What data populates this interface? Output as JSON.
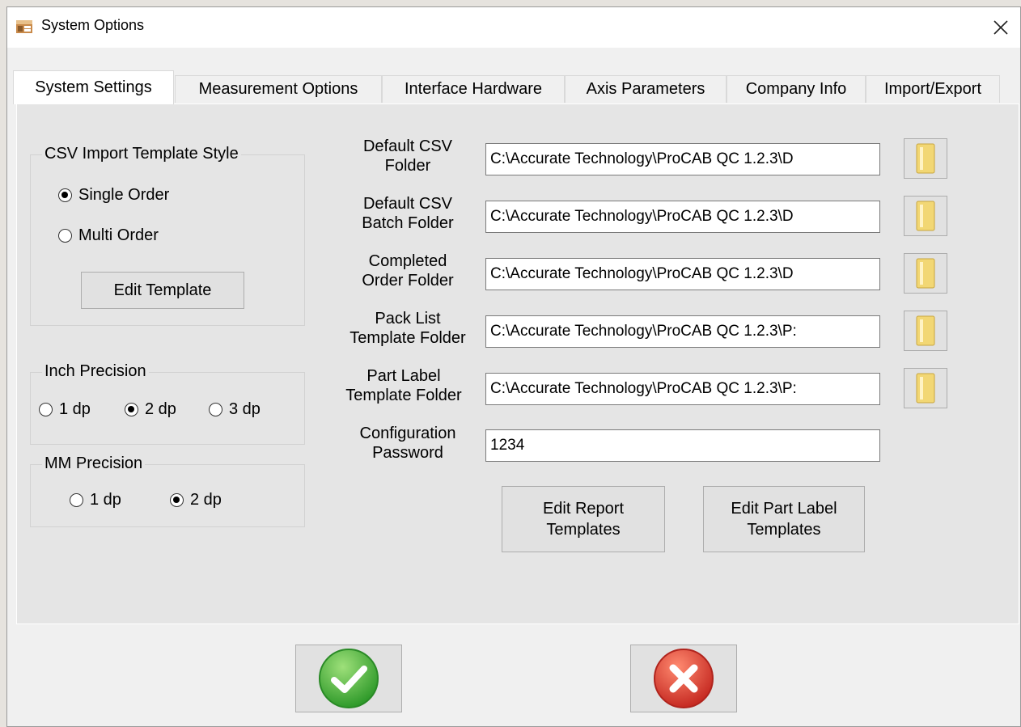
{
  "window": {
    "title": "System Options"
  },
  "tabs": [
    {
      "label": "System Settings"
    },
    {
      "label": "Measurement Options"
    },
    {
      "label": "Interface Hardware"
    },
    {
      "label": "Axis Parameters"
    },
    {
      "label": "Company Info"
    },
    {
      "label": "Import/Export"
    }
  ],
  "csv_template": {
    "legend": "CSV Import Template Style",
    "options": [
      "Single Order",
      "Multi Order"
    ],
    "selected": "Single Order",
    "edit_button": "Edit Template"
  },
  "inch_precision": {
    "legend": "Inch Precision",
    "options": [
      "1 dp",
      "2 dp",
      "3 dp"
    ],
    "selected": "2 dp"
  },
  "mm_precision": {
    "legend": "MM Precision",
    "options": [
      "1 dp",
      "2 dp"
    ],
    "selected": "2 dp"
  },
  "folders": [
    {
      "label": "Default CSV\nFolder",
      "value": "C:\\Accurate Technology\\ProCAB QC 1.2.3\\D"
    },
    {
      "label": "Default CSV\nBatch Folder",
      "value": "C:\\Accurate Technology\\ProCAB QC 1.2.3\\D"
    },
    {
      "label": "Completed\nOrder Folder",
      "value": "C:\\Accurate Technology\\ProCAB QC 1.2.3\\D"
    },
    {
      "label": "Pack List\nTemplate Folder",
      "value": "C:\\Accurate Technology\\ProCAB QC 1.2.3\\P:"
    },
    {
      "label": "Part Label\nTemplate Folder",
      "value": "C:\\Accurate Technology\\ProCAB QC 1.2.3\\P:"
    }
  ],
  "password": {
    "label": "Configuration\nPassword",
    "value": "1234"
  },
  "buttons": {
    "edit_report": "Edit Report\nTemplates",
    "edit_part_label": "Edit Part Label\nTemplates"
  },
  "icons": {
    "ok": "green-checkmark-icon",
    "cancel": "red-x-icon",
    "browse": "folder-icon",
    "close": "close-icon"
  },
  "colors": {
    "ok_green": "#3fae3a",
    "cancel_red": "#d8322a",
    "folder_yellow": "#f2d774"
  }
}
